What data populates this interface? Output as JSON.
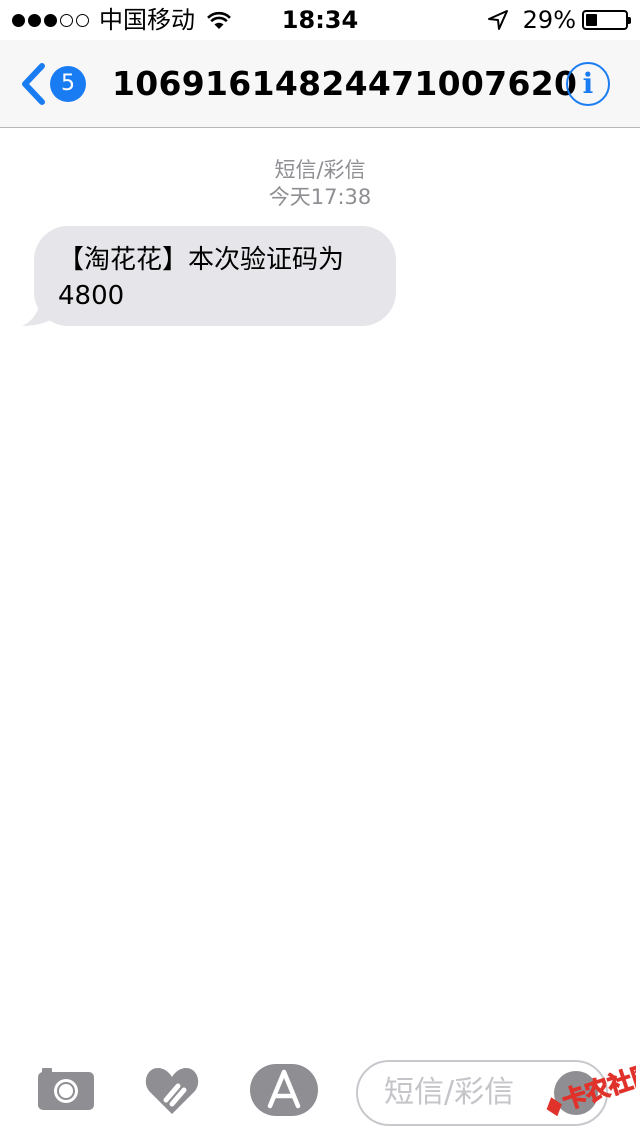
{
  "status_bar": {
    "signal_dots": [
      true,
      true,
      true,
      false,
      false
    ],
    "carrier": "中国移动",
    "time": "18:34",
    "battery_percent_label": "29%",
    "battery_level": 0.29
  },
  "nav": {
    "back_badge": "5",
    "title": "106916148244710076​20",
    "info_label": "i"
  },
  "conversation": {
    "message_type": "短信/彩信",
    "timestamp": "今天17:38",
    "messages": [
      {
        "direction": "incoming",
        "line1": "【淘花花】本次验证码为",
        "line2": "4800"
      }
    ]
  },
  "input_bar": {
    "placeholder": "短信/彩信",
    "icons": [
      "camera-icon",
      "digital-touch-icon",
      "app-store-icon",
      "microphone-icon"
    ]
  },
  "watermark": {
    "text": "卡农社区"
  },
  "colors": {
    "accent": "#1a7cf2",
    "bubble": "#e5e5ea",
    "meta": "#8e8e93",
    "icon_gray": "#8e8e93"
  }
}
